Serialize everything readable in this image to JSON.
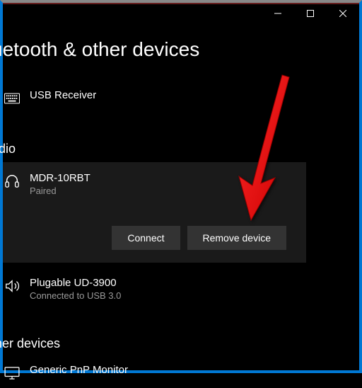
{
  "window": {
    "title": "uetooth & other devices"
  },
  "sections": {
    "other_top": {
      "usb_receiver": {
        "name": "USB Receiver"
      }
    },
    "audio": {
      "header": "udio",
      "selected_device": {
        "name": "MDR-10RBT",
        "status": "Paired"
      },
      "buttons": {
        "connect": "Connect",
        "remove": "Remove device"
      },
      "plugable": {
        "name": "Plugable UD-3900",
        "status": "Connected to USB 3.0"
      }
    },
    "other_bottom": {
      "header": "ther devices",
      "monitor": {
        "name": "Generic PnP Monitor"
      }
    }
  }
}
